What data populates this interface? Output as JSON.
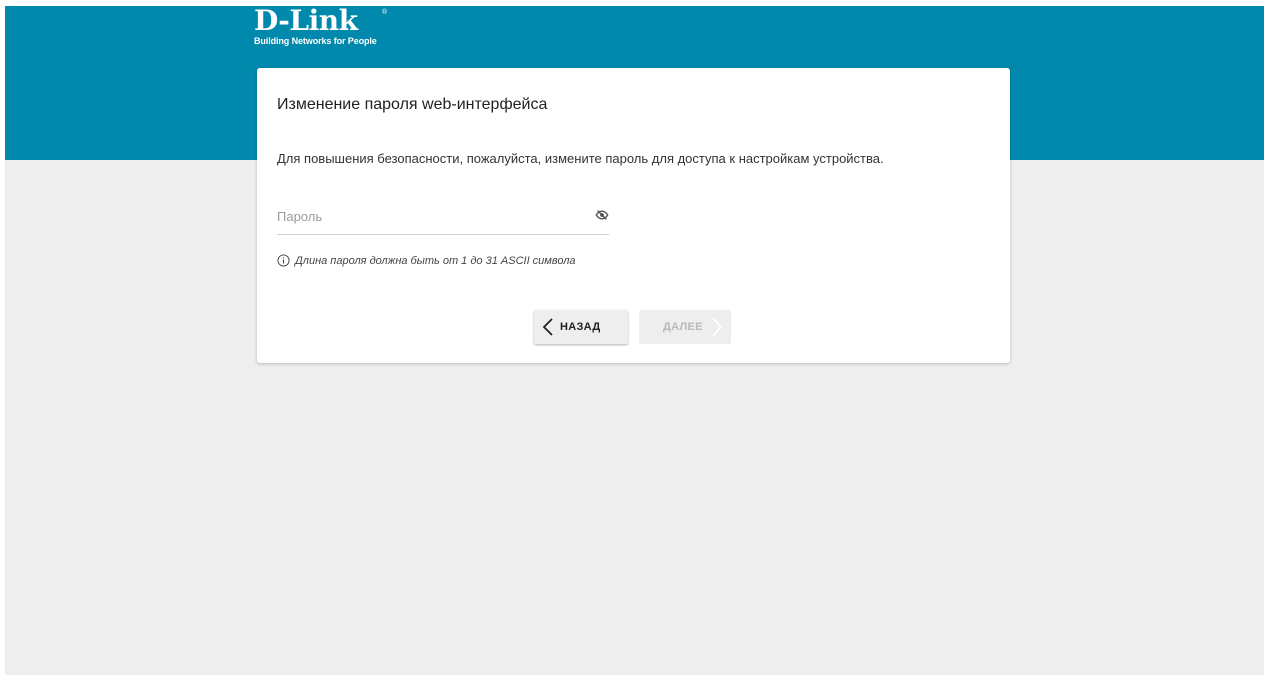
{
  "brand": {
    "name": "D-Link",
    "registered_mark": "®",
    "tagline": "Building Networks for People",
    "primary_color": "#0089ad"
  },
  "dialog": {
    "title": "Изменение пароля web-интерфейса",
    "description": "Для повышения безопасности, пожалуйста, измените пароль для доступа к настройкам устройства.",
    "password_field": {
      "placeholder": "Пароль",
      "value": "",
      "visibility_icon": "eye-off-icon"
    },
    "hint": {
      "icon": "info-icon",
      "text": "Длина пароля должна быть от 1 до 31 ASCII символа"
    },
    "buttons": {
      "back_label": "НАЗАД",
      "next_label": "ДАЛЕЕ",
      "next_disabled": true
    }
  }
}
